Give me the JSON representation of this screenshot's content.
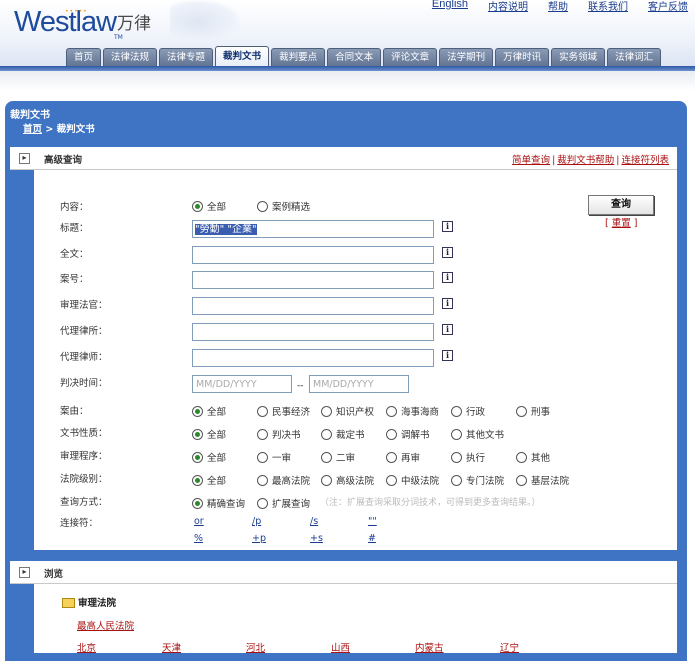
{
  "brand": {
    "logo_text": "Westlaw",
    "logo_cn": "万律",
    "tm": "TM"
  },
  "top_links": [
    "English",
    "内容说明",
    "帮助",
    "联系我们",
    "客户反馈"
  ],
  "tabs": [
    "首页",
    "法律法规",
    "法律专题",
    "裁判文书",
    "裁判要点",
    "合同文本",
    "评论文章",
    "法学期刊",
    "万律时讯",
    "实务领域",
    "法律词汇"
  ],
  "active_tab": "裁判文书",
  "section": {
    "title": "裁判文书",
    "breadcrumb_home": "首页",
    "breadcrumb_sep": " > ",
    "breadcrumb_current": "裁判文书"
  },
  "advanced": {
    "title": "高级查询",
    "links": [
      "简单查询",
      "裁判文书帮助",
      "连接符列表"
    ],
    "link_sep": "|",
    "query_button": "查询",
    "reset": "重置",
    "fields": {
      "content": {
        "label": "内容：",
        "options": [
          "全部",
          "案例精选"
        ],
        "selected": "全部"
      },
      "title": {
        "label": "标题：",
        "value": "\"勞動\" \"企業\""
      },
      "fulltext": {
        "label": "全文：",
        "value": ""
      },
      "case_no": {
        "label": "案号：",
        "value": ""
      },
      "judge": {
        "label": "审理法官：",
        "value": ""
      },
      "law_firm": {
        "label": "代理律所：",
        "value": ""
      },
      "lawyer": {
        "label": "代理律师：",
        "value": ""
      },
      "date": {
        "label": "判决时间：",
        "from_placeholder": "MM/DD/YYYY",
        "to_placeholder": "MM/DD/YYYY",
        "separator": "--"
      },
      "cause": {
        "label": "案由：",
        "options": [
          "全部",
          "民事经济",
          "知识产权",
          "海事海商",
          "行政",
          "刑事"
        ],
        "selected": "全部"
      },
      "doc_type": {
        "label": "文书性质：",
        "options": [
          "全部",
          "判决书",
          "裁定书",
          "调解书",
          "其他文书"
        ],
        "selected": "全部"
      },
      "procedure": {
        "label": "审理程序：",
        "options": [
          "全部",
          "一审",
          "二审",
          "再审",
          "执行",
          "其他"
        ],
        "selected": "全部"
      },
      "court_level": {
        "label": "法院级别：",
        "options": [
          "全部",
          "最高法院",
          "高级法院",
          "中级法院",
          "专门法院",
          "基层法院"
        ],
        "selected": "全部"
      },
      "query_mode": {
        "label": "查询方式：",
        "options": [
          "精确查询",
          "扩展查询"
        ],
        "selected": "精确查询",
        "note": "（注：扩展查询采取分词技术，可得到更多查询结果。）"
      },
      "connectors": {
        "label": "连接符：",
        "row1": [
          "or",
          "/p",
          "/s",
          "\"\""
        ],
        "row2": [
          "%",
          "+p",
          "+s",
          "#"
        ]
      }
    }
  },
  "browse": {
    "title": "浏览",
    "court_heading": "审理法院",
    "supreme": "最高人民法院",
    "provinces": [
      "北京",
      "天津",
      "河北",
      "山西",
      "内蒙古",
      "辽宁"
    ]
  },
  "colors": {
    "frame_blue": "#3f74c4",
    "link_red": "#aa1111",
    "tab_gray": "#6f82a0"
  }
}
